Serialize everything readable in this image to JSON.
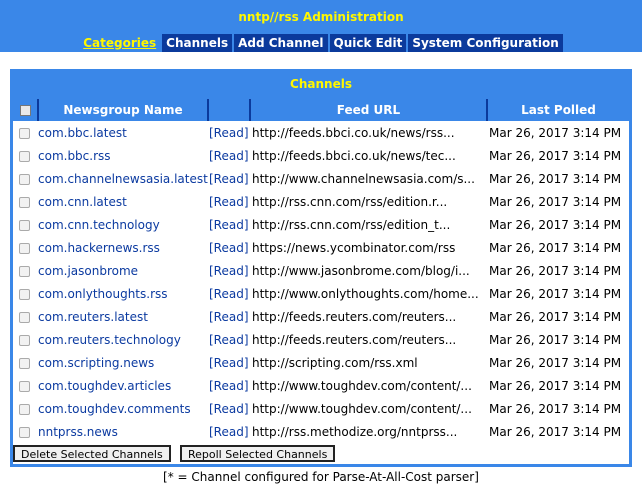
{
  "header": {
    "title": "nntp//rss Administration"
  },
  "nav": [
    {
      "label": "Categories",
      "active": true
    },
    {
      "label": "Channels",
      "active": false
    },
    {
      "label": "Add Channel",
      "active": false
    },
    {
      "label": "Quick Edit",
      "active": false
    },
    {
      "label": "System Configuration",
      "active": false
    }
  ],
  "panel": {
    "title": "Channels"
  },
  "table": {
    "columns": [
      "Newsgroup Name",
      "Feed URL",
      "Last Polled"
    ],
    "rows": [
      {
        "name": "com.bbc.latest",
        "read": "[Read]",
        "url": "http://feeds.bbci.co.uk/news/rss...",
        "polled": "Mar 26, 2017 3:14 PM"
      },
      {
        "name": "com.bbc.rss",
        "read": "[Read]",
        "url": "http://feeds.bbci.co.uk/news/tec...",
        "polled": "Mar 26, 2017 3:14 PM"
      },
      {
        "name": "com.channelnewsasia.latest",
        "read": "[Read]",
        "url": "http://www.channelnewsasia.com/s...",
        "polled": "Mar 26, 2017 3:14 PM"
      },
      {
        "name": "com.cnn.latest",
        "read": "[Read]",
        "url": "http://rss.cnn.com/rss/edition.r...",
        "polled": "Mar 26, 2017 3:14 PM"
      },
      {
        "name": "com.cnn.technology",
        "read": "[Read]",
        "url": "http://rss.cnn.com/rss/edition_t...",
        "polled": "Mar 26, 2017 3:14 PM"
      },
      {
        "name": "com.hackernews.rss",
        "read": "[Read]",
        "url": "https://news.ycombinator.com/rss",
        "polled": "Mar 26, 2017 3:14 PM"
      },
      {
        "name": "com.jasonbrome",
        "read": "[Read]",
        "url": "http://www.jasonbrome.com/blog/i...",
        "polled": "Mar 26, 2017 3:14 PM"
      },
      {
        "name": "com.onlythoughts.rss",
        "read": "[Read]",
        "url": "http://www.onlythoughts.com/home...",
        "polled": "Mar 26, 2017 3:14 PM"
      },
      {
        "name": "com.reuters.latest",
        "read": "[Read]",
        "url": "http://feeds.reuters.com/reuters...",
        "polled": "Mar 26, 2017 3:14 PM"
      },
      {
        "name": "com.reuters.technology",
        "read": "[Read]",
        "url": "http://feeds.reuters.com/reuters...",
        "polled": "Mar 26, 2017 3:14 PM"
      },
      {
        "name": "com.scripting.news",
        "read": "[Read]",
        "url": "http://scripting.com/rss.xml",
        "polled": "Mar 26, 2017 3:14 PM"
      },
      {
        "name": "com.toughdev.articles",
        "read": "[Read]",
        "url": "http://www.toughdev.com/content/...",
        "polled": "Mar 26, 2017 3:14 PM"
      },
      {
        "name": "com.toughdev.comments",
        "read": "[Read]",
        "url": "http://www.toughdev.com/content/...",
        "polled": "Mar 26, 2017 3:14 PM"
      },
      {
        "name": "nntprss.news",
        "read": "[Read]",
        "url": "http://rss.methodize.org/nntprss...",
        "polled": "Mar 26, 2017 3:14 PM"
      }
    ]
  },
  "buttons": {
    "delete": "Delete Selected Channels",
    "repoll": "Repoll Selected Channels"
  },
  "footnote": "[* = Channel configured for Parse-At-All-Cost parser]",
  "colors": {
    "header_bg": "#3a87e8",
    "title_text": "#fff700",
    "nav_bg": "#0b3a9c",
    "link": "#0b3aa0"
  }
}
